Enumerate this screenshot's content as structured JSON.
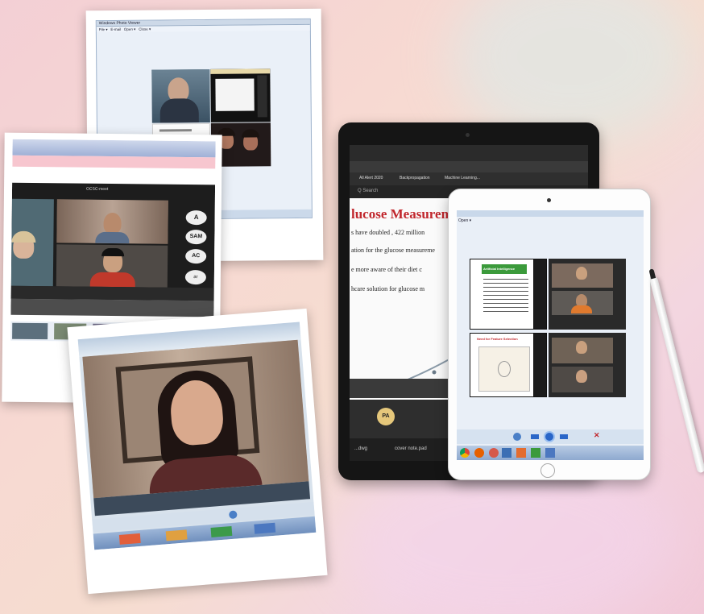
{
  "viewer_window": {
    "title": "Windows Photo Viewer",
    "menu": [
      "File ▾",
      "E-mail",
      "Open ▾",
      "Close ▾"
    ]
  },
  "tablet_dark": {
    "slide_heading": "lucose Measurem",
    "slide_lines": [
      "s have doubled , 422 million",
      "ation for the glucose measureme",
      "e more aware of their diet c",
      "hcare solution for glucose m"
    ],
    "bookmark_items": [
      "All Alert 2020",
      "Backpropagation",
      "Machine Learning..."
    ],
    "address_hint": "Q Search",
    "file_labels": [
      "...dwg",
      "cover note.pad"
    ],
    "participant_initials": "PA"
  },
  "tablet_light": {
    "menu_label": "Open ▾",
    "slide_title": "Artificial Intelligence",
    "slide_heading2": "Need for Feature Selection"
  },
  "zoom_laptop": {
    "window_label": "OCSC-meet",
    "avatars": [
      "A",
      "SAM",
      "AC",
      "ar"
    ]
  },
  "colors": {
    "accent_blue": "#2a66c8",
    "slide_red": "#c1272d",
    "slide_green": "#3b9a3b"
  }
}
